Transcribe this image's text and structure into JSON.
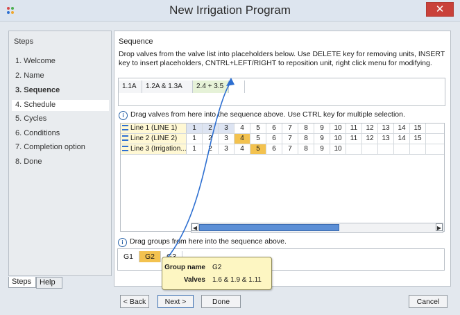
{
  "window": {
    "title": "New Irrigation Program",
    "close_label": "✕"
  },
  "steps": {
    "header": "Steps",
    "items": [
      {
        "label": "1. Welcome"
      },
      {
        "label": "2. Name"
      },
      {
        "label": "3. Sequence",
        "active": true
      },
      {
        "label": "4. Schedule"
      },
      {
        "label": "5. Cycles"
      },
      {
        "label": "6. Conditions"
      },
      {
        "label": "7. Completion option"
      },
      {
        "label": "8. Done"
      }
    ],
    "tabs": [
      "Steps",
      "Help"
    ]
  },
  "sequence": {
    "title": "Sequence",
    "description": "Drop valves from the valve list into placeholders below. Use DELETE key for removing units, INSERT key to insert placeholders, CNTRL+LEFT/RIGHT to reposition unit, right click menu for modifying.",
    "items": [
      "1.1A",
      "1.2A & 1.3A",
      "2.4 + 3.5",
      ""
    ]
  },
  "valves": {
    "hint": "Drag valves from here into the sequence above. Use CTRL key for multiple selection.",
    "rows": [
      {
        "name": "Line 1 (LINE  1)",
        "cells": [
          "1",
          "2",
          "3",
          "4",
          "5",
          "6",
          "7",
          "8",
          "9",
          "10",
          "11",
          "12",
          "13",
          "14",
          "15"
        ]
      },
      {
        "name": "Line 2 (LINE  2)",
        "cells": [
          "1",
          "2",
          "3",
          "4",
          "5",
          "6",
          "7",
          "8",
          "9",
          "10",
          "11",
          "12",
          "13",
          "14",
          "15"
        ]
      },
      {
        "name": "Line 3 (Irrigation...",
        "cells": [
          "1",
          "2",
          "3",
          "4",
          "5",
          "6",
          "7",
          "8",
          "9",
          "10",
          "",
          "",
          "",
          "",
          ""
        ]
      }
    ]
  },
  "groups": {
    "hint": "Drag groups from here into the sequence above.",
    "items": [
      "G1",
      "G2",
      "G3"
    ]
  },
  "tooltip": {
    "group_name_label": "Group name",
    "group_name_value": "G2",
    "valves_label": "Valves",
    "valves_value": "1.6 & 1.9 & 1.11"
  },
  "buttons": {
    "back": "< Back",
    "next": "Next >",
    "done": "Done",
    "cancel": "Cancel"
  },
  "colors": {
    "selected_cell": "#f3c24f",
    "assigned_cell": "#dde4f2",
    "arrow": "#2d6fd1",
    "close": "#c9413a"
  }
}
